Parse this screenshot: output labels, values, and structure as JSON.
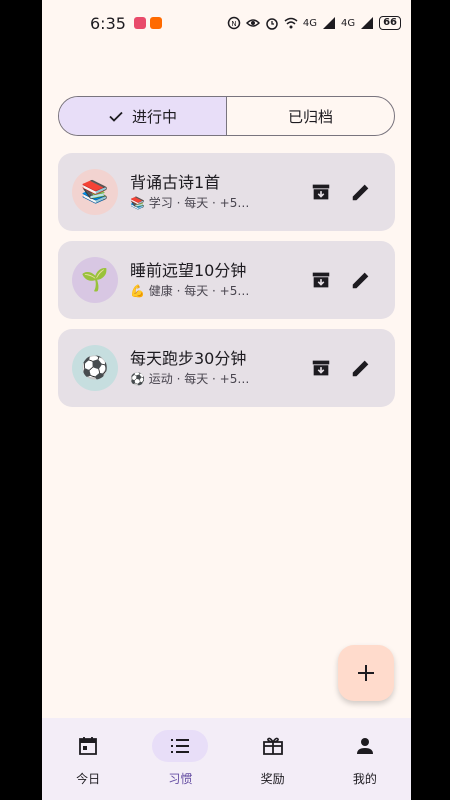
{
  "status_bar": {
    "time": "6:35",
    "battery": "66",
    "network_1": "4G",
    "network_2": "4G"
  },
  "tabs": [
    {
      "label": "进行中",
      "active": true
    },
    {
      "label": "已归档",
      "active": false
    }
  ],
  "habits": [
    {
      "icon": "📚",
      "title": "背诵古诗1首",
      "meta": "📚 学习 · 每天 · +5…",
      "avatar_color": "#F2D3D0"
    },
    {
      "icon": "🌱",
      "title": "睡前远望10分钟",
      "meta": "💪 健康 · 每天 · +5…",
      "avatar_color": "#D8C7E3"
    },
    {
      "icon": "⚽",
      "title": "每天跑步30分钟",
      "meta": "⚽ 运动 · 每天 · +5…",
      "avatar_color": "#C6DEDF"
    }
  ],
  "nav": [
    {
      "label": "今日",
      "icon": "calendar-icon",
      "active": false
    },
    {
      "label": "习惯",
      "icon": "list-icon",
      "active": true
    },
    {
      "label": "奖励",
      "icon": "gift-icon",
      "active": false
    },
    {
      "label": "我的",
      "icon": "person-icon",
      "active": false
    }
  ],
  "colors": {
    "background": "#FFF7F2",
    "active_tab": "#E8DEF8",
    "card": "#E6E0E6",
    "fab": "#FFDBCC",
    "nav_active": "#6750A4"
  }
}
